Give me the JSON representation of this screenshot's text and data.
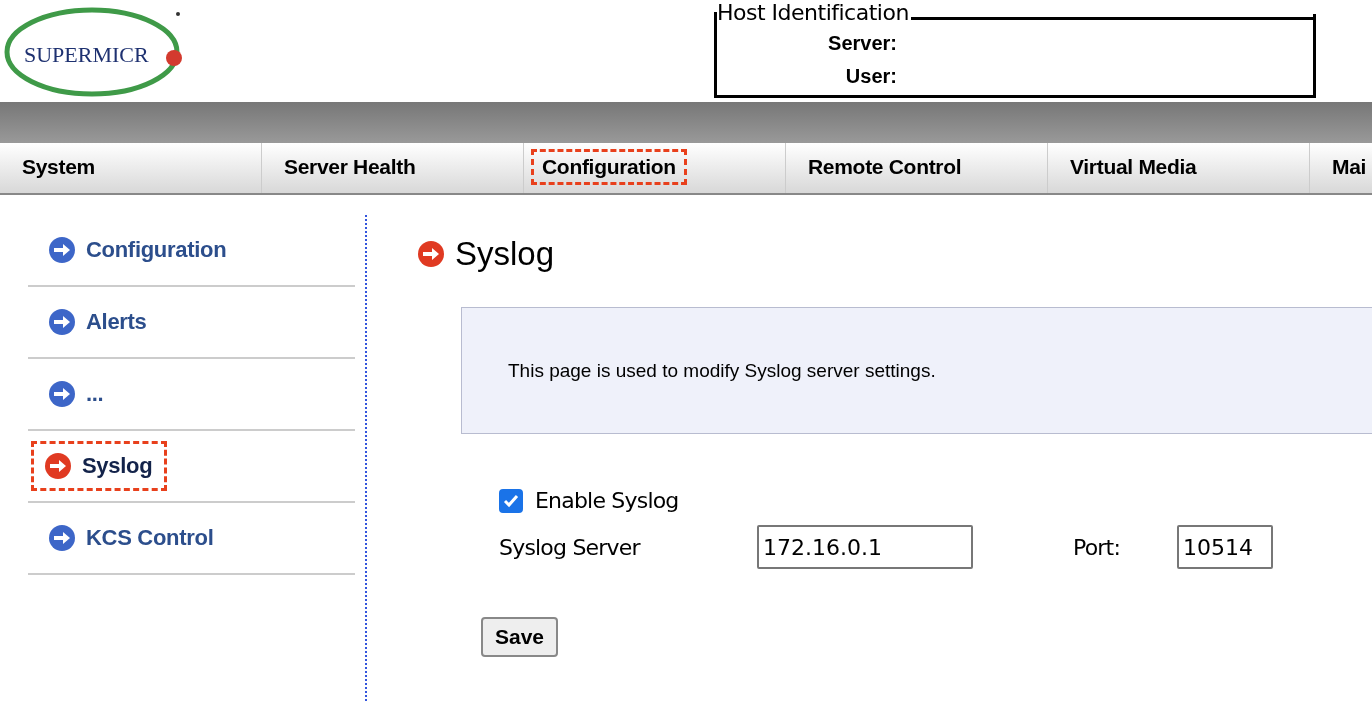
{
  "logo": {
    "text": "SUPERMICR"
  },
  "host_identification": {
    "title": "Host Identification",
    "fields": [
      {
        "label": "Server:"
      },
      {
        "label": "User:"
      }
    ]
  },
  "nav_tabs": [
    {
      "label": "System",
      "highlighted": false
    },
    {
      "label": "Server Health",
      "highlighted": false
    },
    {
      "label": "Configuration",
      "highlighted": true
    },
    {
      "label": "Remote Control",
      "highlighted": false
    },
    {
      "label": "Virtual Media",
      "highlighted": false
    },
    {
      "label": "Mai",
      "highlighted": false
    }
  ],
  "sidebar": {
    "items": [
      {
        "label": "Configuration",
        "selected": false,
        "highlighted": false
      },
      {
        "label": "Alerts",
        "selected": false,
        "highlighted": false
      },
      {
        "label": "...",
        "selected": false,
        "highlighted": false
      },
      {
        "label": "Syslog",
        "selected": true,
        "highlighted": true
      },
      {
        "label": "KCS Control",
        "selected": false,
        "highlighted": false
      }
    ]
  },
  "page": {
    "title": "Syslog",
    "description": "This page is used to modify Syslog server settings.",
    "enable": {
      "label": "Enable Syslog",
      "checked": true
    },
    "server": {
      "label": "Syslog Server",
      "value": "172.16.0.1"
    },
    "port": {
      "label": "Port:",
      "value": "10514"
    },
    "save_button": "Save"
  }
}
